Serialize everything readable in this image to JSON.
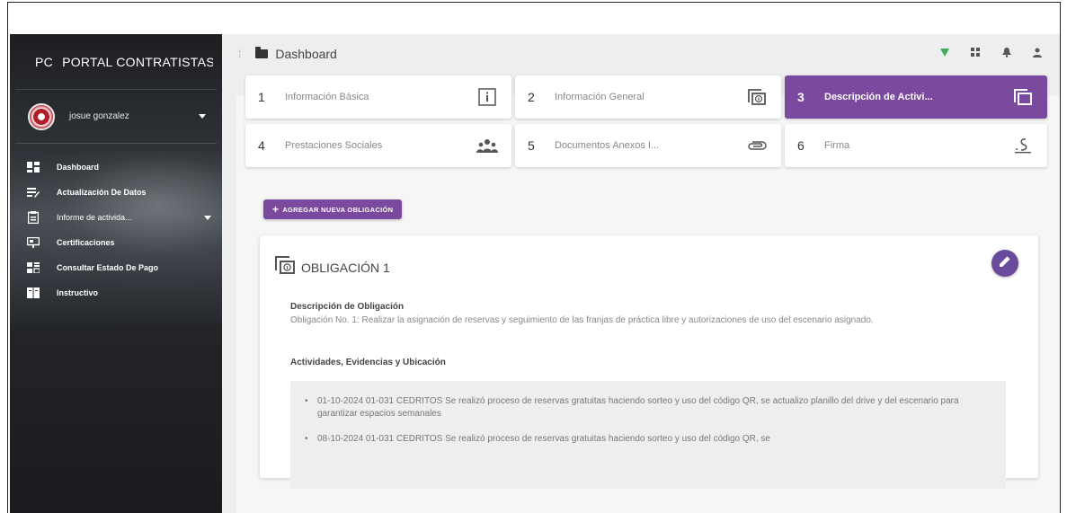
{
  "sidebar": {
    "brand_mini": "PC",
    "brand_full": "PORTAL CONTRATISTAS",
    "user_name": "josue gonzalez",
    "items": [
      {
        "label": "Dashboard",
        "icon": "dashboard-icon"
      },
      {
        "label": "Actualización De Datos",
        "icon": "edit-data-icon"
      },
      {
        "label": "Informe de activida...",
        "icon": "report-icon"
      },
      {
        "label": "Certificaciones",
        "icon": "certificate-icon"
      },
      {
        "label": "Consultar Estado De Pago",
        "icon": "payment-status-icon"
      },
      {
        "label": "Instructivo",
        "icon": "book-icon"
      }
    ]
  },
  "topbar": {
    "title": "Dashboard",
    "icons": [
      "filter-icon",
      "apps-icon",
      "bell-icon",
      "person-icon"
    ]
  },
  "steps": [
    {
      "num": "1",
      "label": "Información Básica",
      "icon": "info-icon",
      "active": false
    },
    {
      "num": "2",
      "label": "Información General",
      "icon": "copy-info-icon",
      "active": false
    },
    {
      "num": "3",
      "label": "Descripción de Activi...",
      "icon": "copy-icon",
      "active": true
    },
    {
      "num": "4",
      "label": "Prestaciones Sociales",
      "icon": "group-icon",
      "active": false
    },
    {
      "num": "5",
      "label": "Documentos Anexos I...",
      "icon": "attachment-icon",
      "active": false
    },
    {
      "num": "6",
      "label": "Firma",
      "icon": "signature-icon",
      "active": false
    }
  ],
  "add_button": {
    "plus": "+",
    "label": "AGREGAR NUEVA OBLIGACIÓN"
  },
  "obligation": {
    "title": "OBLIGACIÓN 1",
    "description_heading": "Descripción de Obligación",
    "description_text": "Obligación No. 1: Realizar la asignación de reservas y seguimiento de las franjas de práctica libre y autorizaciones de uso del escenario asignado.",
    "activities_heading": "Actividades, Evidencias y Ubicación",
    "activities": [
      "01-10-2024 01-031 CEDRITOS Se realizó proceso de reservas gratuitas haciendo sorteo y uso del código QR, se actualizo planillo del drive y del escenario para garantizar espacios semanales",
      "08-10-2024 01-031 CEDRITOS Se realizó proceso de reservas gratuitas haciendo sorteo y uso del código QR, se"
    ]
  },
  "colors": {
    "accent": "#7b4a9e",
    "fab": "#6a4a9c",
    "filter": "#3fae5a"
  }
}
